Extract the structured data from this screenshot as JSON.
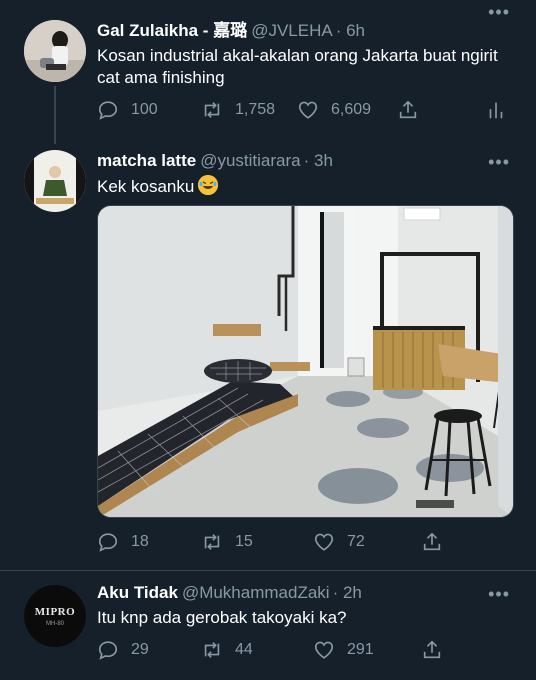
{
  "tweets": [
    {
      "name": "Gal Zulaikha - 嘉璐",
      "handle": "@JVLEHA",
      "time": "· 6h",
      "text": "Kosan industrial akal-akalan orang Jakarta buat ngirit cat ama finishing",
      "replies": "100",
      "retweets": "1,758",
      "likes": "6,609",
      "more": "•••"
    },
    {
      "name": "matcha latte",
      "handle": "@yustitiarara",
      "time": "· 3h",
      "text": "Kek kosanku",
      "emoji": "rofl-emoji",
      "replies": "18",
      "retweets": "15",
      "likes": "72",
      "more": "•••"
    },
    {
      "name": "Aku Tidak",
      "handle": "@MukhammadZaki",
      "time": "· 2h",
      "text": "Itu knp ada gerobak takoyaki ka?",
      "avatar_text": "MIPRO",
      "avatar_subtext": "MH-80",
      "replies": "29",
      "retweets": "44",
      "likes": "291",
      "more": "•••"
    }
  ],
  "colors": {
    "background": "#15202b",
    "secondary_text": "#8899a6",
    "divider": "#38444d"
  }
}
